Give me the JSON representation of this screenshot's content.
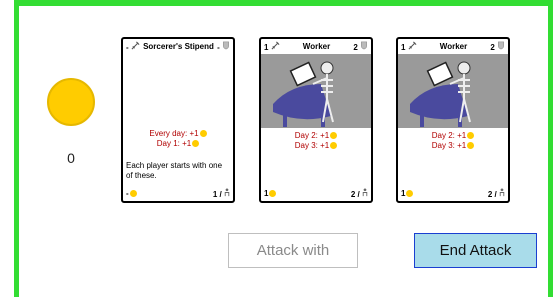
{
  "colors": {
    "board_border": "#33dd33",
    "coin": "#ffcc00",
    "end_button_bg": "#a9dcea",
    "end_button_border": "#1a3fd1",
    "card_text_red": "#b00000"
  },
  "coins": {
    "count": "0",
    "icon": "coin-icon"
  },
  "cards": [
    {
      "name": "Sorcerer's Stipend",
      "top_left": "-",
      "top_right": "-",
      "lines": [
        {
          "text": "Every day: +1"
        },
        {
          "text": "Day 1: +1"
        }
      ],
      "description": "Each player starts with one of these.",
      "cost": "-",
      "count": "1 /"
    },
    {
      "name": "Worker",
      "top_left": "1",
      "top_right": "2",
      "lines": [
        {
          "text": "Day 2: +1"
        },
        {
          "text": "Day 3: +1"
        }
      ],
      "description": "",
      "cost": "1",
      "count": "2 /"
    },
    {
      "name": "Worker",
      "top_left": "1",
      "top_right": "2",
      "lines": [
        {
          "text": "Day 2: +1"
        },
        {
          "text": "Day 3: +1"
        }
      ],
      "description": "",
      "cost": "1",
      "count": "2 /"
    }
  ],
  "buttons": {
    "attack_label": "Attack with",
    "end_label": "End Attack"
  }
}
